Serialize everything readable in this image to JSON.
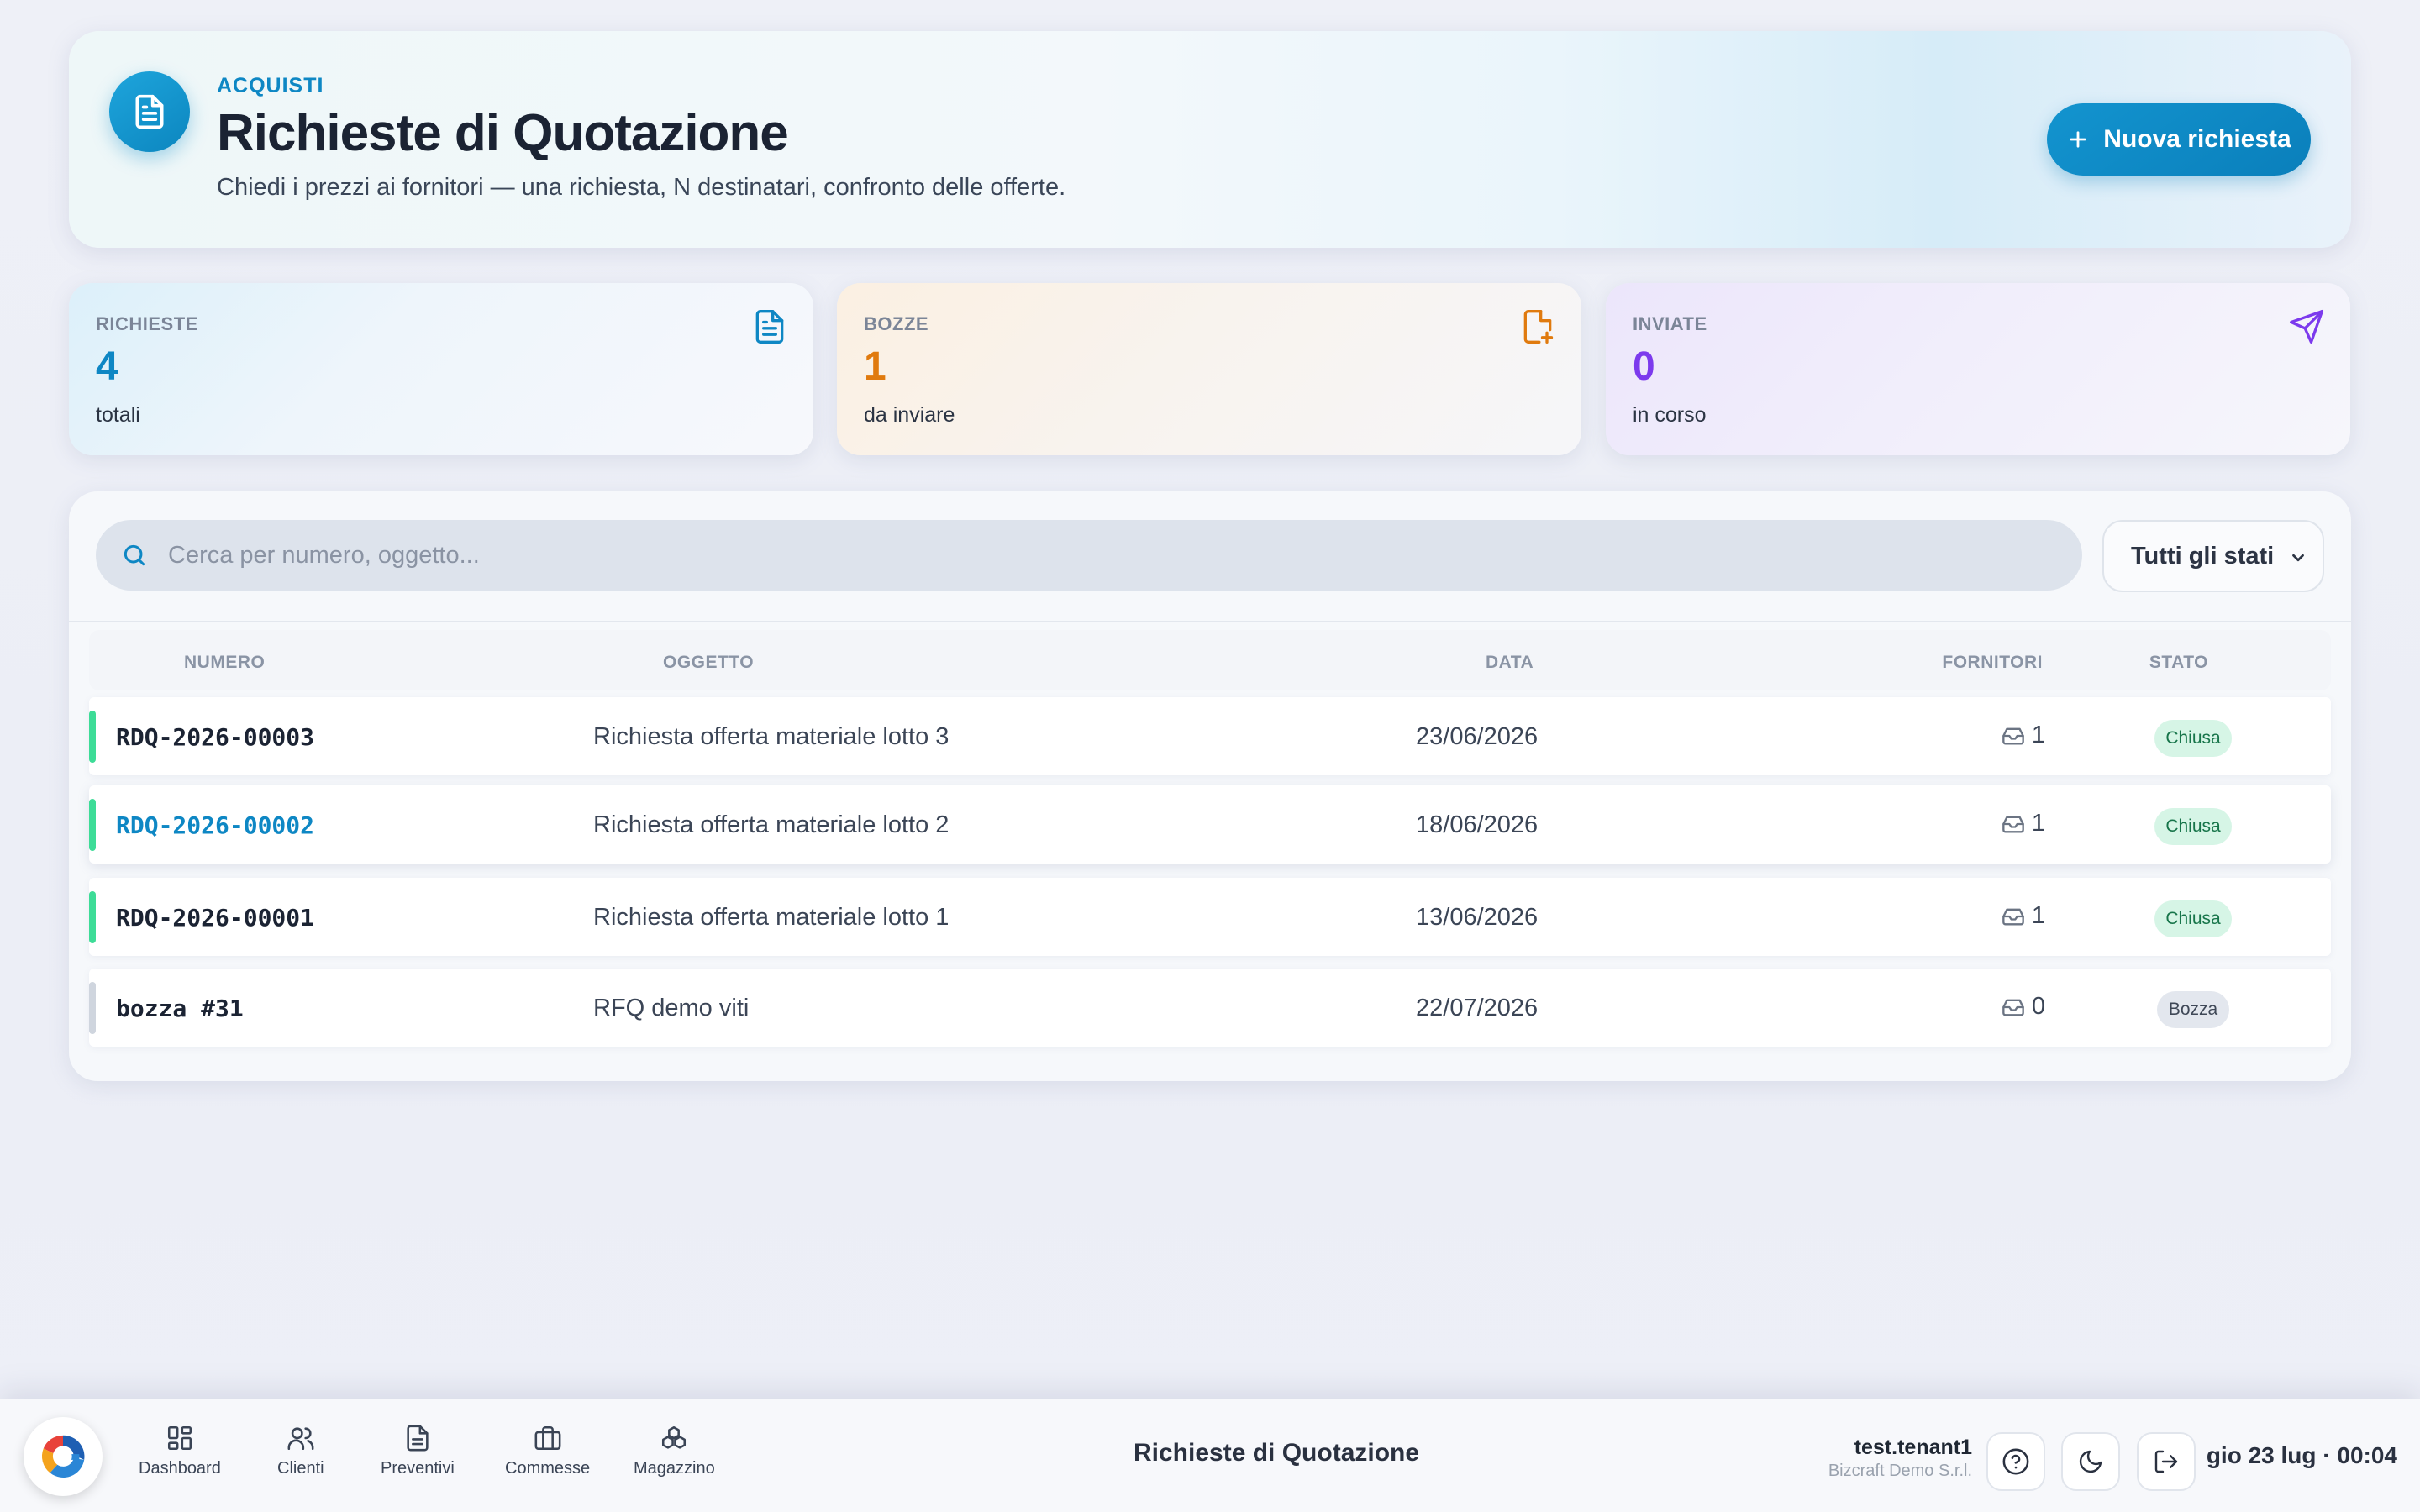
{
  "header": {
    "kicker": "ACQUISTI",
    "title": "Richieste di Quotazione",
    "subtitle": "Chiedi i prezzi ai fornitori — una richiesta, N destinatari, confronto delle offerte.",
    "new_button": "Nuova richiesta"
  },
  "stats": [
    {
      "label": "RICHIESTE",
      "value": "4",
      "sub": "totali",
      "color": "#0e87c4",
      "icon": "document-icon"
    },
    {
      "label": "BOZZE",
      "value": "1",
      "sub": "da inviare",
      "color": "#e07a0e",
      "icon": "file-plus-icon"
    },
    {
      "label": "INVIATE",
      "value": "0",
      "sub": "in corso",
      "color": "#7c3aed",
      "icon": "send-icon"
    }
  ],
  "search": {
    "placeholder": "Cerca per numero, oggetto..."
  },
  "filter": {
    "selected": "Tutti gli stati"
  },
  "table": {
    "headers": {
      "numero": "NUMERO",
      "oggetto": "OGGETTO",
      "data": "DATA",
      "fornitori": "FORNITORI",
      "stato": "STATO"
    },
    "rows": [
      {
        "numero": "RDQ-2026-00003",
        "oggetto": "Richiesta offerta materiale lotto 3",
        "data": "23/06/2026",
        "fornitori": "1",
        "stato": "Chiusa"
      },
      {
        "numero": "RDQ-2026-00002",
        "oggetto": "Richiesta offerta materiale lotto 2",
        "data": "18/06/2026",
        "fornitori": "1",
        "stato": "Chiusa"
      },
      {
        "numero": "RDQ-2026-00001",
        "oggetto": "Richiesta offerta materiale lotto 1",
        "data": "13/06/2026",
        "fornitori": "1",
        "stato": "Chiusa"
      },
      {
        "numero": "bozza #31",
        "oggetto": "RFQ demo viti",
        "data": "22/07/2026",
        "fornitori": "0",
        "stato": "Bozza"
      }
    ]
  },
  "dock": {
    "nav": [
      "Dashboard",
      "Clienti",
      "Preventivi",
      "Commesse",
      "Magazzino"
    ],
    "title": "Richieste di Quotazione",
    "user": "test.tenant1",
    "company": "Bizcraft Demo S.r.l.",
    "clock": "gio 23 lug · 00:04"
  },
  "colors": {
    "accent": "#0e87c4",
    "closed": "#3ddc97",
    "draft": "#cfd5de",
    "link": "#0e87c4"
  }
}
